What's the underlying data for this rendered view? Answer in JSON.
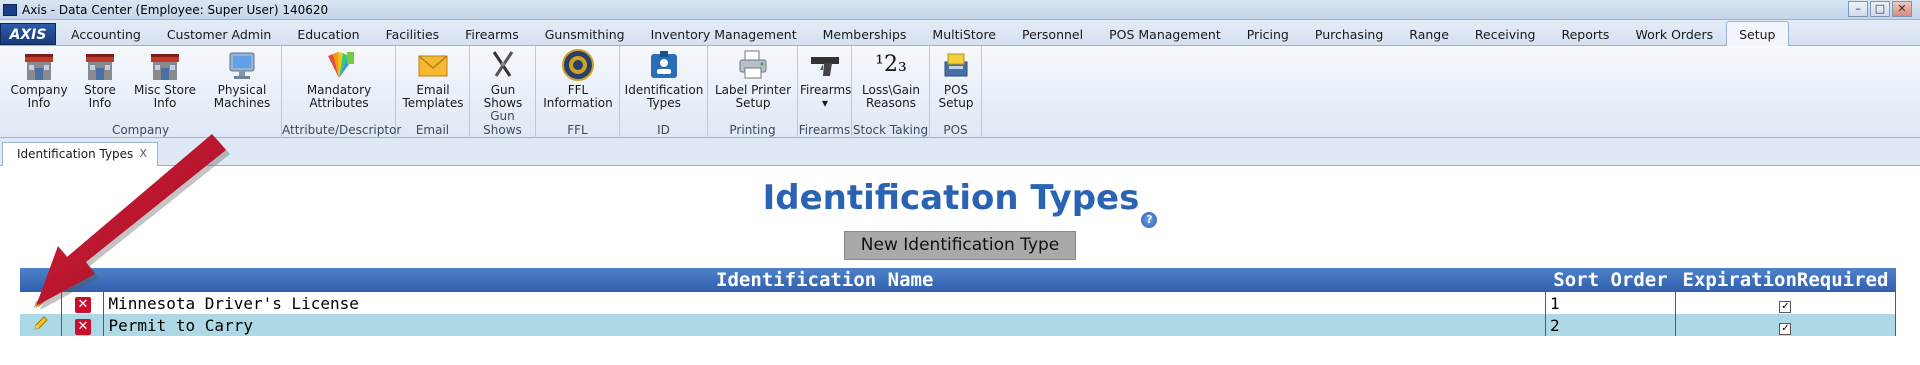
{
  "window": {
    "title": "Axis - Data Center  (Employee: Super User) 140620",
    "minimize": "–",
    "maximize": "□",
    "close": "✕"
  },
  "menu": {
    "logo": "AXIS",
    "tabs": [
      "Accounting",
      "Customer Admin",
      "Education",
      "Facilities",
      "Firearms",
      "Gunsmithing",
      "Inventory Management",
      "Memberships",
      "MultiStore",
      "Personnel",
      "POS Management",
      "Pricing",
      "Purchasing",
      "Range",
      "Receiving",
      "Reports",
      "Work Orders",
      "Setup"
    ],
    "active": "Setup"
  },
  "ribbon": {
    "groups": [
      {
        "label": "Company",
        "buttons": [
          {
            "line1": "Company",
            "line2": "Info",
            "icon": "store-icon"
          },
          {
            "line1": "Store",
            "line2": "Info",
            "icon": "store-icon"
          },
          {
            "line1": "Misc Store",
            "line2": "Info",
            "icon": "store-icon"
          },
          {
            "line1": "Physical",
            "line2": "Machines",
            "icon": "monitor-icon"
          }
        ]
      },
      {
        "label": "Attribute/Descriptor",
        "buttons": [
          {
            "line1": "Mandatory",
            "line2": "Attributes",
            "icon": "color-swatch-icon"
          }
        ]
      },
      {
        "label": "Email",
        "buttons": [
          {
            "line1": "Email",
            "line2": "Templates",
            "icon": "envelope-icon"
          }
        ]
      },
      {
        "label": "Gun Shows",
        "buttons": [
          {
            "line1": "Gun",
            "line2": "Shows",
            "icon": "crossed-guns-icon"
          }
        ]
      },
      {
        "label": "FFL",
        "buttons": [
          {
            "line1": "FFL",
            "line2": "Information",
            "icon": "seal-icon"
          }
        ]
      },
      {
        "label": "ID",
        "buttons": [
          {
            "line1": "Identification",
            "line2": "Types",
            "icon": "id-badge-icon"
          }
        ]
      },
      {
        "label": "Printing",
        "buttons": [
          {
            "line1": "Label Printer",
            "line2": "Setup",
            "icon": "printer-icon"
          }
        ]
      },
      {
        "label": "Firearms",
        "buttons": [
          {
            "line1": "Firearms",
            "line2": "▾",
            "icon": "pistol-icon"
          }
        ]
      },
      {
        "label": "Stock Taking",
        "buttons": [
          {
            "line1": "Loss\\Gain",
            "line2": "Reasons",
            "icon": "numbers-icon",
            "glyph": "¹2₃"
          }
        ]
      },
      {
        "label": "POS",
        "buttons": [
          {
            "line1": "POS",
            "line2": "Setup",
            "icon": "pos-icon"
          }
        ]
      }
    ]
  },
  "doc_tab": {
    "label": "Identification Types",
    "close": "X"
  },
  "page": {
    "heading": "Identification Types",
    "help": "?",
    "new_button": "New Identification Type"
  },
  "table": {
    "headers": [
      "",
      "",
      "Identification Name",
      "Sort Order",
      "ExpirationRequired"
    ],
    "rows": [
      {
        "name": "Minnesota Driver's License",
        "sort": "1",
        "expiration_required": "✓"
      },
      {
        "name": "Permit to Carry",
        "sort": "2",
        "expiration_required": "✓"
      }
    ]
  },
  "colors": {
    "heading": "#2a63b4",
    "header_bg": "#2f5fae",
    "alt_row": "#add8e6",
    "arrow": "#c8102e"
  }
}
